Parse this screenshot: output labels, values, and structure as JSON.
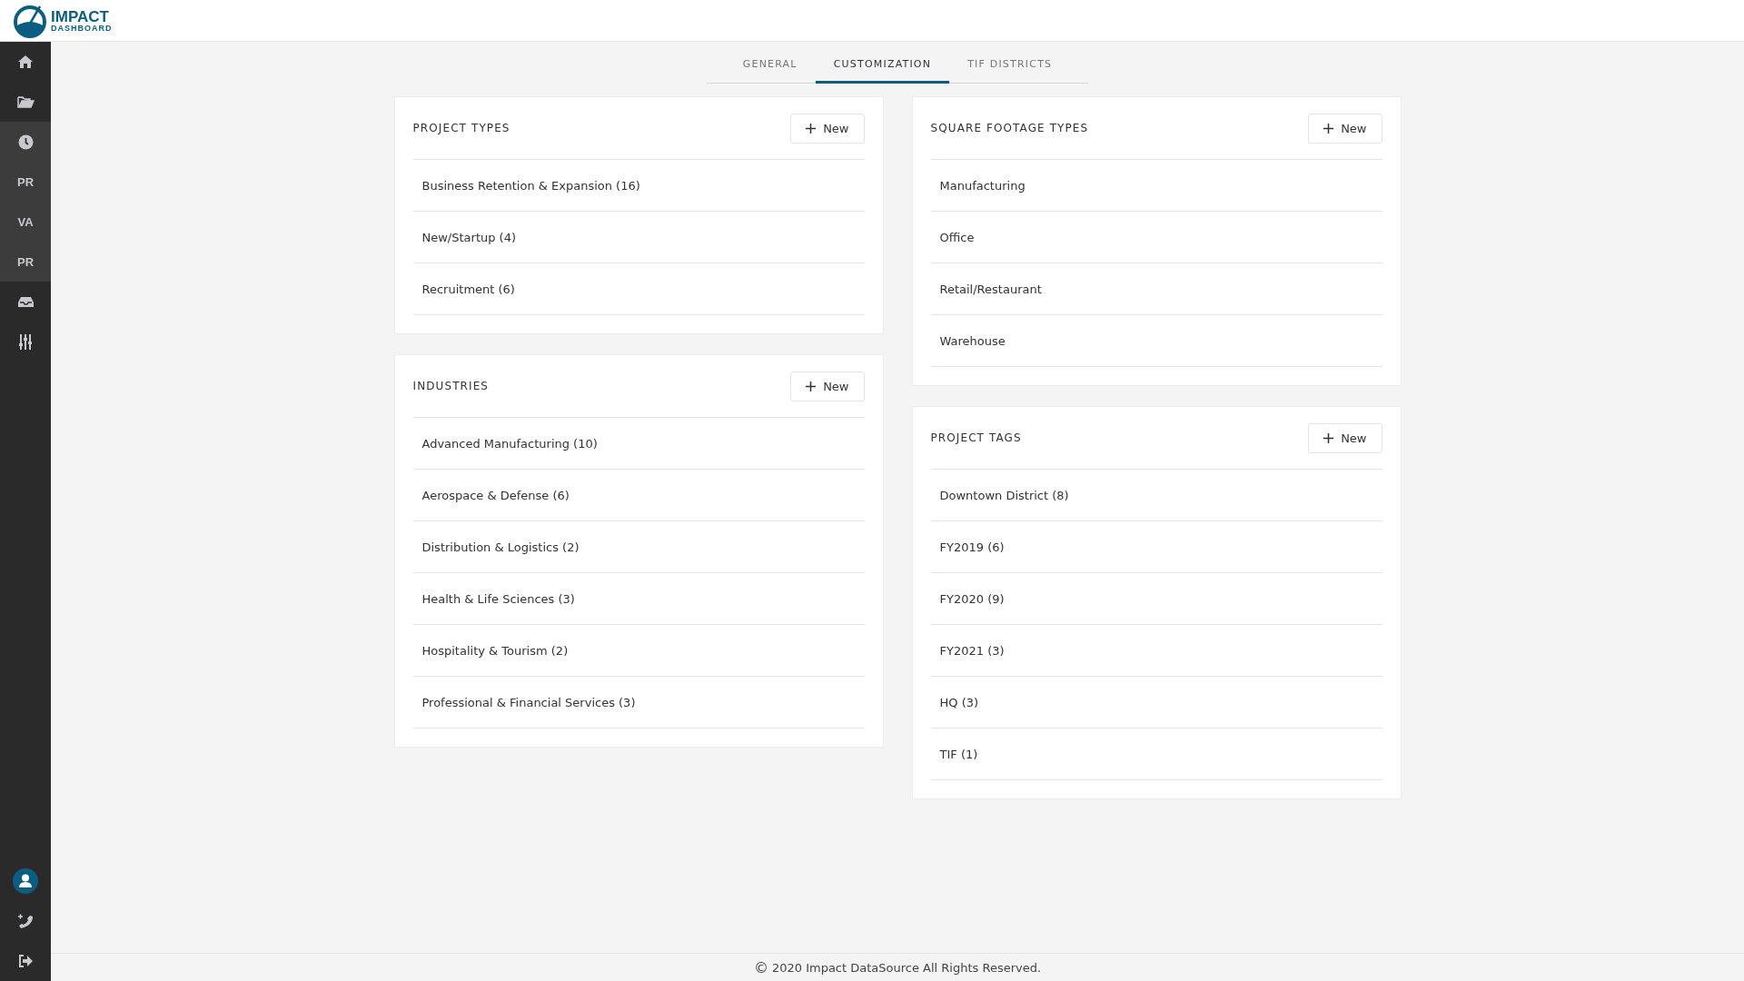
{
  "logo": {
    "title": "IMPACT",
    "subtitle": "DASHBOARD"
  },
  "sidebar": {
    "items": [
      {
        "kind": "home",
        "highlighted": false
      },
      {
        "kind": "folder",
        "highlighted": false
      },
      {
        "kind": "clock",
        "highlighted": true
      },
      {
        "kind": "text",
        "label": "PR",
        "highlighted": true
      },
      {
        "kind": "text",
        "label": "VA",
        "highlighted": true
      },
      {
        "kind": "text",
        "label": "PR",
        "highlighted": true
      },
      {
        "kind": "inbox",
        "highlighted": false
      },
      {
        "kind": "sliders",
        "highlighted": false
      }
    ],
    "bottom_items": [
      {
        "kind": "user"
      },
      {
        "kind": "phone"
      },
      {
        "kind": "logout"
      }
    ]
  },
  "tabs": [
    {
      "label": "GENERAL",
      "selected": false
    },
    {
      "label": "CUSTOMIZATION",
      "selected": true
    },
    {
      "label": "TIF DISTRICTS",
      "selected": false
    }
  ],
  "columns": [
    [
      {
        "title": "PROJECT TYPES",
        "button": "New",
        "items": [
          "Business Retention & Expansion (16)",
          "New/Startup (4)",
          "Recruitment (6)"
        ]
      },
      {
        "title": "INDUSTRIES",
        "button": "New",
        "items": [
          "Advanced Manufacturing (10)",
          "Aerospace & Defense (6)",
          "Distribution & Logistics (2)",
          "Health & Life Sciences (3)",
          "Hospitality & Tourism (2)",
          "Professional & Financial Services (3)"
        ]
      }
    ],
    [
      {
        "title": "SQUARE FOOTAGE TYPES",
        "button": "New",
        "items": [
          "Manufacturing",
          "Office",
          "Retail/Restaurant",
          "Warehouse"
        ]
      },
      {
        "title": "PROJECT TAGS",
        "button": "New",
        "items": [
          "Downtown District (8)",
          "FY2019 (6)",
          "FY2020 (9)",
          "FY2021 (3)",
          "HQ (3)",
          "TIF (1)"
        ]
      }
    ]
  ],
  "footer": {
    "symbol": "©",
    "text": "2020 Impact DataSource All Rights Reserved."
  }
}
